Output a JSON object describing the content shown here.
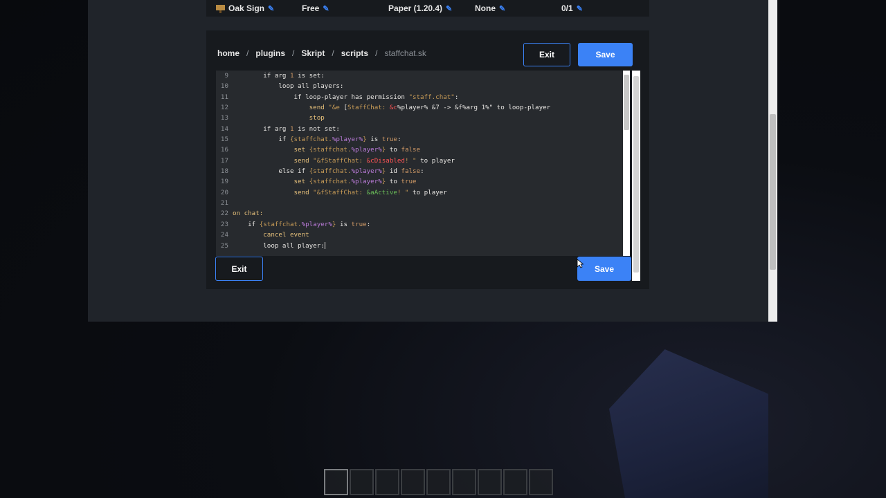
{
  "topbar": {
    "items": [
      {
        "label": "Oak Sign",
        "icon": "sign-icon"
      },
      {
        "label": "Free"
      },
      {
        "label": "Paper (1.20.4)"
      },
      {
        "label": "None"
      },
      {
        "label": "0/1"
      }
    ]
  },
  "breadcrumb": {
    "parts": [
      "home",
      "plugins",
      "Skript",
      "scripts"
    ],
    "current": "staffchat.sk",
    "separator": "/"
  },
  "buttons": {
    "exit": "Exit",
    "save": "Save"
  },
  "code": {
    "lines": [
      {
        "n": "9",
        "segs": [
          [
            "w",
            "        if arg "
          ],
          [
            "o",
            "1"
          ],
          [
            "w",
            " is set:"
          ]
        ]
      },
      {
        "n": "10",
        "segs": [
          [
            "w",
            "            loop all players:"
          ]
        ]
      },
      {
        "n": "11",
        "segs": [
          [
            "w",
            "                if loop-player has permission "
          ],
          [
            "s",
            "\"staff.chat\""
          ],
          [
            "w",
            ":"
          ]
        ]
      },
      {
        "n": "12",
        "segs": [
          [
            "k",
            "                    send "
          ],
          [
            "s",
            "\"&e "
          ],
          [
            "w",
            "["
          ],
          [
            "s",
            "StaffChat: "
          ],
          [
            "r",
            "&c"
          ],
          [
            "w",
            "%player% &7 -> &f%arg 1%\" to loop-player"
          ]
        ]
      },
      {
        "n": "13",
        "segs": [
          [
            "k",
            "                    stop"
          ]
        ]
      },
      {
        "n": "14",
        "segs": [
          [
            "w",
            "        if arg "
          ],
          [
            "o",
            "1"
          ],
          [
            "w",
            " is not set:"
          ]
        ]
      },
      {
        "n": "15",
        "segs": [
          [
            "w",
            "            if "
          ],
          [
            "s",
            "{staffchat."
          ],
          [
            "v",
            "%player%"
          ],
          [
            "s",
            "}"
          ],
          [
            "w",
            " is "
          ],
          [
            "o",
            "true"
          ],
          [
            "w",
            ":"
          ]
        ]
      },
      {
        "n": "16",
        "segs": [
          [
            "k",
            "                set "
          ],
          [
            "s",
            "{staffchat."
          ],
          [
            "v",
            "%player%"
          ],
          [
            "s",
            "}"
          ],
          [
            "w",
            " to "
          ],
          [
            "o",
            "false"
          ]
        ]
      },
      {
        "n": "17",
        "segs": [
          [
            "k",
            "                send "
          ],
          [
            "s",
            "\"&fStaffChat: "
          ],
          [
            "r",
            "&cDisabled"
          ],
          [
            "s",
            "! \""
          ],
          [
            "w",
            " to player"
          ]
        ]
      },
      {
        "n": "18",
        "segs": [
          [
            "w",
            "            else if "
          ],
          [
            "s",
            "{staffchat."
          ],
          [
            "v",
            "%player%"
          ],
          [
            "s",
            "}"
          ],
          [
            "w",
            " id "
          ],
          [
            "o",
            "false"
          ],
          [
            "w",
            ":"
          ]
        ]
      },
      {
        "n": "19",
        "segs": [
          [
            "k",
            "                set "
          ],
          [
            "s",
            "{staffchat."
          ],
          [
            "v",
            "%player%"
          ],
          [
            "s",
            "}"
          ],
          [
            "w",
            " to "
          ],
          [
            "o",
            "true"
          ]
        ]
      },
      {
        "n": "20",
        "segs": [
          [
            "k",
            "                send "
          ],
          [
            "s",
            "\"&fStaffChat: "
          ],
          [
            "g",
            "&aActive"
          ],
          [
            "s",
            "! \""
          ],
          [
            "w",
            " to player"
          ]
        ]
      },
      {
        "n": "21",
        "segs": [
          [
            "w",
            ""
          ]
        ]
      },
      {
        "n": "22",
        "segs": [
          [
            "k",
            "on chat:"
          ]
        ]
      },
      {
        "n": "23",
        "segs": [
          [
            "w",
            "    if "
          ],
          [
            "s",
            "{staffchat."
          ],
          [
            "v",
            "%player%"
          ],
          [
            "s",
            "}"
          ],
          [
            "w",
            " is "
          ],
          [
            "o",
            "true"
          ],
          [
            "w",
            ":"
          ]
        ]
      },
      {
        "n": "24",
        "segs": [
          [
            "k",
            "        cancel event"
          ]
        ]
      },
      {
        "n": "25",
        "segs": [
          [
            "w",
            "        loop all player:"
          ]
        ]
      }
    ]
  },
  "colors": {
    "accent": "#3b82f6",
    "panel": "#171a1e",
    "editor": "#272a2e"
  }
}
